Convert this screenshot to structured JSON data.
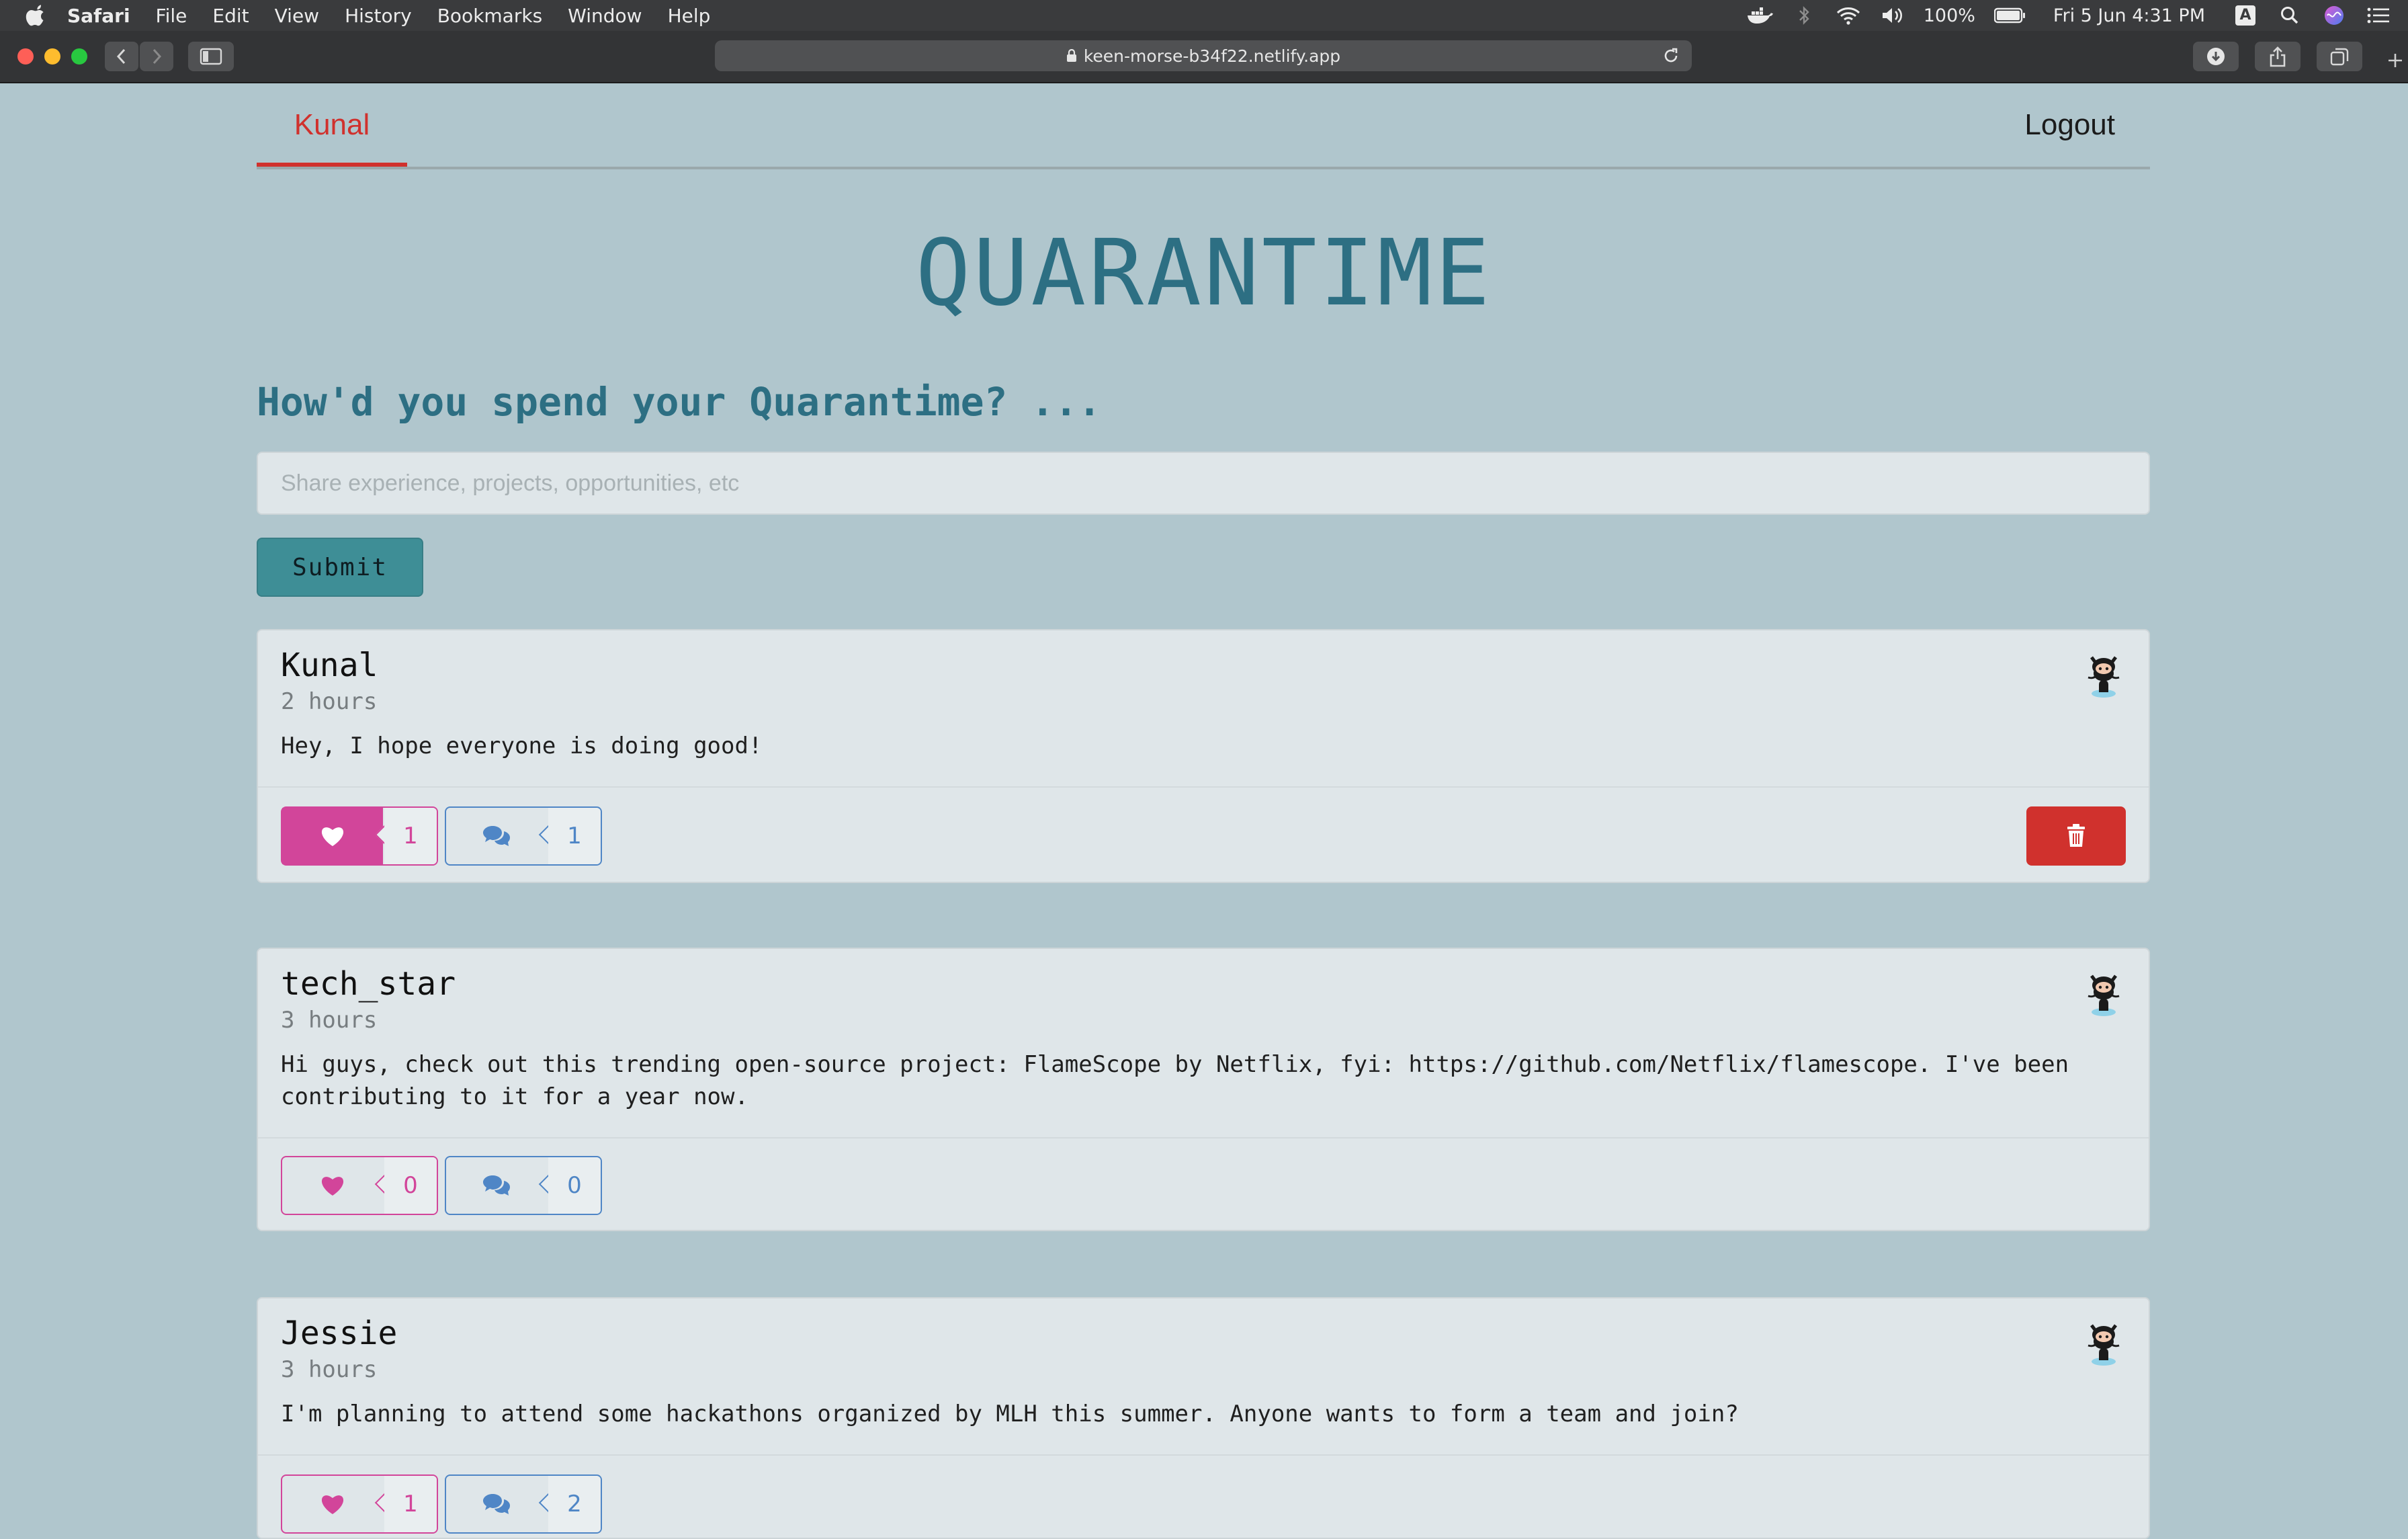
{
  "menubar": {
    "app": "Safari",
    "items": [
      "File",
      "Edit",
      "View",
      "History",
      "Bookmarks",
      "Window",
      "Help"
    ],
    "battery": "100%",
    "clock": "Fri 5 Jun  4:31 PM",
    "input_source": "A"
  },
  "browser": {
    "url": "keen-morse-b34f22.netlify.app"
  },
  "nav": {
    "user": "Kunal",
    "logout": "Logout"
  },
  "header": {
    "title": "QUARANTIME",
    "subtitle": "How'd you spend your Quarantime? ..."
  },
  "composer": {
    "placeholder": "Share experience, projects, opportunities, etc",
    "value": "",
    "submit_label": "Submit"
  },
  "posts": [
    {
      "author": "Kunal",
      "time": "2 hours",
      "text": "Hey, I hope everyone is doing good!",
      "likes": "1",
      "comments": "1",
      "liked": true,
      "deletable": true
    },
    {
      "author": "tech_star",
      "time": "3 hours",
      "text": "Hi guys, check out this trending open-source project: FlameScope by Netflix, fyi: https://github.com/Netflix/flamescope. I've been contributing to it for a year now.",
      "likes": "0",
      "comments": "0",
      "liked": false,
      "deletable": false
    },
    {
      "author": "Jessie",
      "time": "3 hours",
      "text": "I'm planning to attend some hackathons organized by MLH this summer. Anyone wants to form a team and join?",
      "likes": "1",
      "comments": "2",
      "liked": false,
      "deletable": false
    }
  ],
  "colors": {
    "accent_red": "#d0312d",
    "title_teal": "#2d6f83",
    "like_pink": "#d2459a",
    "comment_blue": "#4f86c6",
    "submit_teal": "#3e8e96"
  }
}
